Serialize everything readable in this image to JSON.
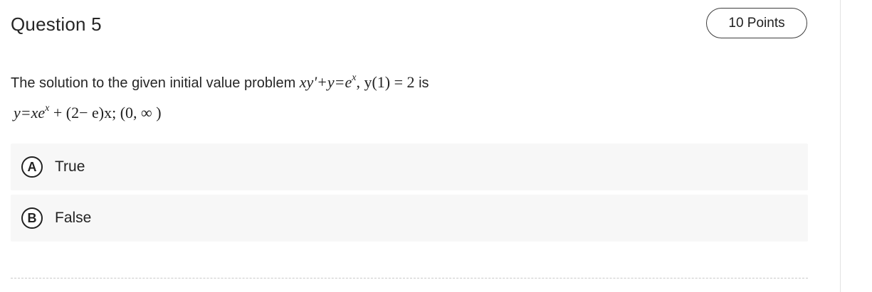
{
  "question": {
    "title": "Question 5",
    "points": "10 Points",
    "prompt": {
      "text_before": "The solution to the given initial value problem ",
      "equation_main": "xy'+y=e",
      "equation_exp": "x",
      "equation_rest": ", y(1) = 2",
      "text_after": " is",
      "solution_main": "y=xe",
      "solution_exp": "x",
      "solution_rest": " + (2− e)x; (0, ∞ )"
    },
    "choices": [
      {
        "letter": "A",
        "label": "True"
      },
      {
        "letter": "B",
        "label": "False"
      }
    ]
  }
}
